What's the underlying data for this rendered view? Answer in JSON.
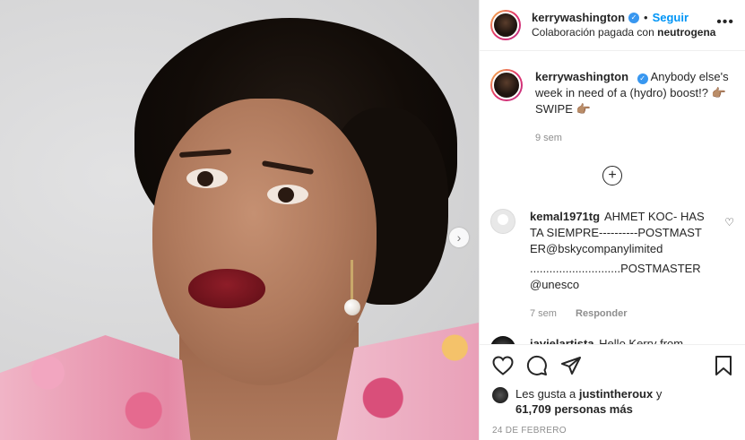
{
  "header": {
    "username": "kerrywashington",
    "follow_label": "Seguir",
    "dot": "•",
    "subtitle_prefix": "Colaboración pagada con",
    "partner": "neutrogena",
    "more_icon": "more-horizontal-icon"
  },
  "caption": {
    "username": "kerrywashington",
    "text": "Anybody else's week in need of a (hydro) boost!? 👉🏽 SWIPE 👉🏽",
    "time": "9 sem"
  },
  "load_more_icon": "plus-circle-icon",
  "comments": [
    {
      "username": "kemal1971tg",
      "text": "AHMET KOC- HASTA SIEMPRE----------POSTMASTER@bskycompanylimited",
      "text2": "............................POSTMASTER@unesco",
      "time": "7 sem",
      "reply": "Responder"
    },
    {
      "username": "javielartista",
      "text": "Hello Kerry from"
    }
  ],
  "actions": {
    "likes_prefix": "Les gusta a",
    "likes_user": "justintheroux",
    "likes_and": "y",
    "likes_count": "61,709 personas más",
    "date": "24 DE FEBRERO"
  },
  "colors": {
    "accent": "#0095f6",
    "verified": "#3897f0",
    "muted": "#8e8e8e"
  }
}
